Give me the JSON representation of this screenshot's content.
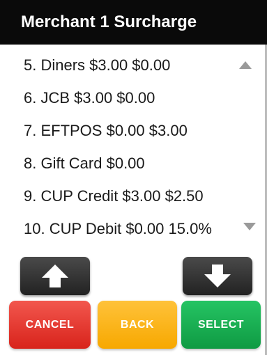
{
  "header": {
    "title": "Merchant 1 Surcharge"
  },
  "list": {
    "items": [
      {
        "label": "5. Diners $3.00  $0.00"
      },
      {
        "label": "6. JCB $3.00  $0.00"
      },
      {
        "label": "7. EFTPOS $0.00  $3.00"
      },
      {
        "label": "8. Gift Card $0.00"
      },
      {
        "label": "9. CUP Credit $3.00  $2.50"
      },
      {
        "label": "10. CUP Debit $0.00  15.0%"
      }
    ]
  },
  "scroll": {
    "up_icon": "triangle-up-icon",
    "down_icon": "triangle-down-icon"
  },
  "nav": {
    "up_icon": "arrow-up-icon",
    "down_icon": "arrow-down-icon"
  },
  "buttons": {
    "cancel_label": "CANCEL",
    "back_label": "BACK",
    "select_label": "SELECT"
  },
  "colors": {
    "title_bar": "#0a0a0a",
    "cancel": "#e0342b",
    "back": "#fbb41c",
    "select": "#17ab51",
    "nav": "#2e2e2e"
  }
}
